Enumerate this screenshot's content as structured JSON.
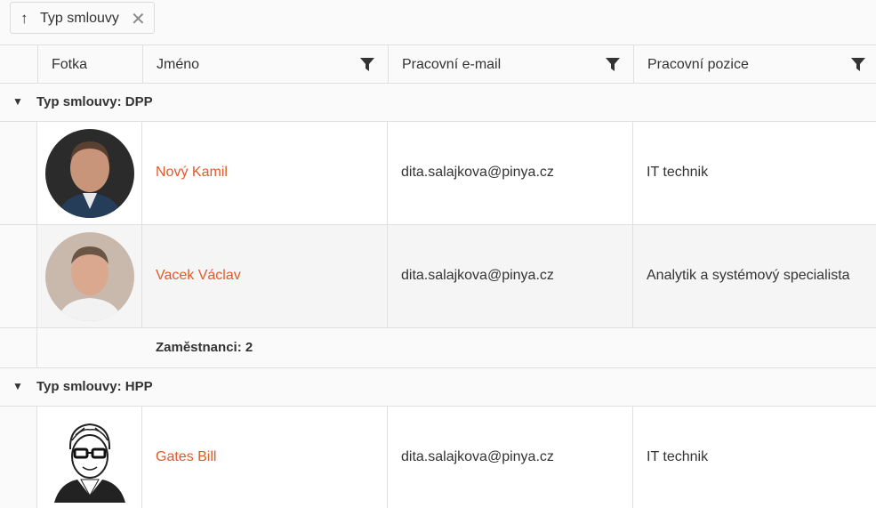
{
  "group_panel": {
    "chip_label": "Typ smlouvy"
  },
  "columns": {
    "photo": "Fotka",
    "name": "Jméno",
    "email": "Pracovní e-mail",
    "position": "Pracovní pozice"
  },
  "groups": [
    {
      "label": "Typ smlouvy: DPP",
      "rows": [
        {
          "name": "Nový Kamil",
          "email": "dita.salajkova@pinya.cz",
          "position": "IT technik",
          "avatar": "photo-man-dark-background"
        },
        {
          "name": "Vacek Václav",
          "email": "dita.salajkova@pinya.cz",
          "position": "Analytik a systémový specialista",
          "avatar": "photo-man-light-background"
        }
      ],
      "summary": "Zaměstnanci: 2"
    },
    {
      "label": "Typ smlouvy: HPP",
      "rows": [
        {
          "name": "Gates Bill",
          "email": "dita.salajkova@pinya.cz",
          "position": "IT technik",
          "avatar": "sketch-man-glasses"
        }
      ]
    }
  ],
  "colors": {
    "name_link": "#e05a2b",
    "border": "#e0e0e0",
    "header_bg": "#fafafa"
  }
}
